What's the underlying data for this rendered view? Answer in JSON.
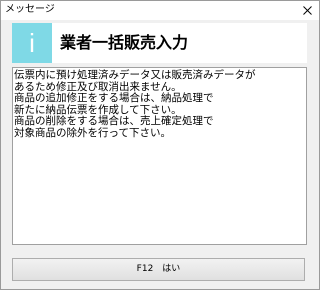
{
  "window": {
    "title": "メッセージ",
    "close_icon": "close-icon"
  },
  "header": {
    "icon_glyph": "i",
    "icon_name": "info-icon",
    "icon_color": "#7fd9e6",
    "title": "業者一括販売入力"
  },
  "message": {
    "lines": [
      "伝票内に預け処理済みデータ又は販売済みデータが",
      "あるため修正及び取消出来ません。",
      "商品の追加修正をする場合は、納品処理で",
      "新たに納品伝票を作成して下さい。",
      "商品の削除をする場合は、売上確定処理で",
      "対象商品の除外を行って下さい。"
    ]
  },
  "buttons": {
    "ok_label": "F12　はい"
  }
}
